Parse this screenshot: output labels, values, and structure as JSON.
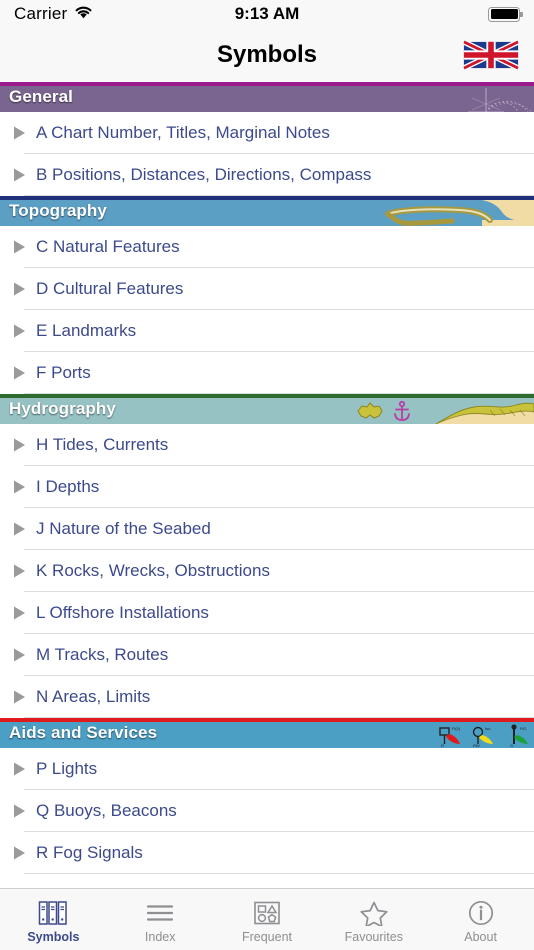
{
  "status_bar": {
    "carrier": "Carrier",
    "time": "9:13 AM",
    "wifi_icon": "wifi-icon",
    "battery_icon": "battery-full-icon"
  },
  "nav_bar": {
    "title": "Symbols",
    "flag_button": "union-jack-flag-icon"
  },
  "colors": {
    "row_text": "#3c4a8c",
    "general_header_bg": "#7a6590",
    "general_header_border": "#9c1a8c",
    "topography_header_bg": "#5c9fc4",
    "topography_header_border": "#1f2f7a",
    "hydrography_header_bg": "#96c2c4",
    "hydrography_header_border": "#2e6b2e",
    "aids_header_bg": "#4b9ec4",
    "aids_header_border": "#e01b1b",
    "tab_active": "#3c4a8c",
    "tab_inactive": "#8e8e93"
  },
  "sections": [
    {
      "title": "General",
      "art": "compass-rose-art",
      "rows": [
        {
          "label": "A Chart Number, Titles, Marginal Notes"
        },
        {
          "label": "B Positions, Distances, Directions, Compass"
        }
      ]
    },
    {
      "title": "Topography",
      "art": "coastline-art",
      "rows": [
        {
          "label": "C Natural Features"
        },
        {
          "label": "D Cultural Features"
        },
        {
          "label": "E Landmarks"
        },
        {
          "label": "F Ports"
        }
      ]
    },
    {
      "title": "Hydrography",
      "art": "seabed-anchor-art",
      "rows": [
        {
          "label": "H Tides, Currents"
        },
        {
          "label": "I Depths"
        },
        {
          "label": "J Nature of the Seabed"
        },
        {
          "label": "K Rocks, Wrecks, Obstructions"
        },
        {
          "label": "L Offshore Installations"
        },
        {
          "label": "M Tracks, Routes"
        },
        {
          "label": "N Areas, Limits"
        }
      ]
    },
    {
      "title": "Aids and Services",
      "art": "buoys-lights-art",
      "rows": [
        {
          "label": "P Lights"
        },
        {
          "label": "Q Buoys, Beacons"
        },
        {
          "label": "R Fog Signals"
        }
      ]
    }
  ],
  "tabs": [
    {
      "label": "Symbols",
      "icon": "binders-icon",
      "active": true
    },
    {
      "label": "Index",
      "icon": "list-lines-icon",
      "active": false
    },
    {
      "label": "Frequent",
      "icon": "shapes-grid-icon",
      "active": false
    },
    {
      "label": "Favourites",
      "icon": "star-icon",
      "active": false
    },
    {
      "label": "About",
      "icon": "info-circle-icon",
      "active": false
    }
  ]
}
